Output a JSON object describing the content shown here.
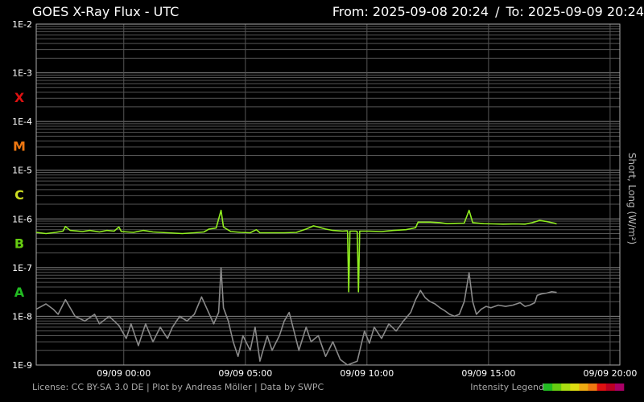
{
  "chart_data": {
    "type": "line",
    "title": "GOES X-Ray Flux - UTC",
    "range": {
      "from": "From: 2025-09-08 20:24",
      "sep": "/",
      "to": "To: 2025-09-09 20:24"
    },
    "ylabel": "Short, Long (W/m²)",
    "yscale": "log",
    "ylim": [
      1e-09,
      0.01
    ],
    "y_ticks": [
      "1E-9",
      "1E-8",
      "1E-7",
      "1E-6",
      "1E-5",
      "1E-4",
      "1E-3",
      "1E-2"
    ],
    "flare_classes": [
      {
        "label": "A",
        "color": "#22bb22",
        "y": 3.16e-08
      },
      {
        "label": "B",
        "color": "#66cc11",
        "y": 3.16e-07
      },
      {
        "label": "C",
        "color": "#ccdd22",
        "y": 3.16e-06
      },
      {
        "label": "M",
        "color": "#ee7711",
        "y": 3.16e-05
      },
      {
        "label": "X",
        "color": "#dd1111",
        "y": 0.000316
      }
    ],
    "x_range_hours": [
      20.4,
      44.4
    ],
    "x_ticks": [
      {
        "label": "09/09 00:00",
        "h": 24
      },
      {
        "label": "09/09 05:00",
        "h": 29
      },
      {
        "label": "09/09 10:00",
        "h": 34
      },
      {
        "label": "09/09 15:00",
        "h": 39
      },
      {
        "label": "09/09 20:00",
        "h": 44
      }
    ],
    "grid": true,
    "series": [
      {
        "color": "#90ee20",
        "points": [
          [
            20.4,
            5.3e-07
          ],
          [
            20.8,
            5e-07
          ],
          [
            21.2,
            5.3e-07
          ],
          [
            21.5,
            5.6e-07
          ],
          [
            21.6,
            7e-07
          ],
          [
            21.8,
            5.8e-07
          ],
          [
            22.3,
            5.5e-07
          ],
          [
            22.6,
            5.8e-07
          ],
          [
            23.0,
            5.4e-07
          ],
          [
            23.3,
            5.8e-07
          ],
          [
            23.6,
            5.6e-07
          ],
          [
            23.8,
            6.8e-07
          ],
          [
            23.9,
            5.5e-07
          ],
          [
            24.4,
            5.3e-07
          ],
          [
            24.8,
            5.8e-07
          ],
          [
            25.2,
            5.4e-07
          ],
          [
            25.8,
            5.2e-07
          ],
          [
            26.4,
            5e-07
          ],
          [
            26.9,
            5.2e-07
          ],
          [
            27.3,
            5.4e-07
          ],
          [
            27.5,
            6.2e-07
          ],
          [
            27.8,
            6.5e-07
          ],
          [
            28.0,
            1.5e-06
          ],
          [
            28.1,
            6.8e-07
          ],
          [
            28.4,
            5.5e-07
          ],
          [
            28.8,
            5.3e-07
          ],
          [
            29.2,
            5.2e-07
          ],
          [
            29.45,
            6e-07
          ],
          [
            29.6,
            5.2e-07
          ],
          [
            30.0,
            5.2e-07
          ],
          [
            30.6,
            5.2e-07
          ],
          [
            31.1,
            5.3e-07
          ],
          [
            31.5,
            6.2e-07
          ],
          [
            31.8,
            7.2e-07
          ],
          [
            32.0,
            6.8e-07
          ],
          [
            32.3,
            6.2e-07
          ],
          [
            32.6,
            5.8e-07
          ],
          [
            33.0,
            5.6e-07
          ],
          [
            33.2,
            5.7e-07
          ],
          [
            33.25,
            3.2e-08
          ],
          [
            33.3,
            5.6e-07
          ],
          [
            33.55,
            5.6e-07
          ],
          [
            33.6,
            5.5e-07
          ],
          [
            33.65,
            3.2e-08
          ],
          [
            33.7,
            5.6e-07
          ],
          [
            34.1,
            5.6e-07
          ],
          [
            34.6,
            5.5e-07
          ],
          [
            35.1,
            5.8e-07
          ],
          [
            35.6,
            6e-07
          ],
          [
            36.0,
            6.6e-07
          ],
          [
            36.1,
            8.6e-07
          ],
          [
            36.6,
            8.6e-07
          ],
          [
            37.0,
            8.4e-07
          ],
          [
            37.3,
            8e-07
          ],
          [
            37.6,
            8.1e-07
          ],
          [
            38.0,
            8.2e-07
          ],
          [
            38.2,
            1.5e-06
          ],
          [
            38.35,
            8.4e-07
          ],
          [
            38.8,
            8e-07
          ],
          [
            39.2,
            7.9e-07
          ],
          [
            39.6,
            7.8e-07
          ],
          [
            40.1,
            7.9e-07
          ],
          [
            40.5,
            7.8e-07
          ],
          [
            40.8,
            8.4e-07
          ],
          [
            41.1,
            9.3e-07
          ],
          [
            41.4,
            8.8e-07
          ],
          [
            41.7,
            8.2e-07
          ],
          [
            41.8,
            7.9e-07
          ]
        ]
      },
      {
        "color": "#8a8a8a",
        "points": [
          [
            20.4,
            1.4e-08
          ],
          [
            20.8,
            1.8e-08
          ],
          [
            21.1,
            1.4e-08
          ],
          [
            21.3,
            1.1e-08
          ],
          [
            21.6,
            2.2e-08
          ],
          [
            22.0,
            1e-08
          ],
          [
            22.4,
            8e-09
          ],
          [
            22.8,
            1.1e-08
          ],
          [
            23.0,
            7e-09
          ],
          [
            23.4,
            1e-08
          ],
          [
            23.8,
            6.5e-09
          ],
          [
            24.1,
            3.5e-09
          ],
          [
            24.3,
            7e-09
          ],
          [
            24.6,
            2.5e-09
          ],
          [
            24.9,
            7e-09
          ],
          [
            25.2,
            3e-09
          ],
          [
            25.5,
            6e-09
          ],
          [
            25.8,
            3.5e-09
          ],
          [
            26.0,
            6e-09
          ],
          [
            26.3,
            1e-08
          ],
          [
            26.6,
            8e-09
          ],
          [
            26.9,
            1.1e-08
          ],
          [
            27.2,
            2.5e-08
          ],
          [
            27.4,
            1.5e-08
          ],
          [
            27.7,
            7e-09
          ],
          [
            27.9,
            1.2e-08
          ],
          [
            28.0,
            1e-07
          ],
          [
            28.1,
            1.5e-08
          ],
          [
            28.3,
            8e-09
          ],
          [
            28.5,
            3e-09
          ],
          [
            28.7,
            1.5e-09
          ],
          [
            28.9,
            4e-09
          ],
          [
            29.2,
            2e-09
          ],
          [
            29.4,
            6e-09
          ],
          [
            29.6,
            1.2e-09
          ],
          [
            29.9,
            4e-09
          ],
          [
            30.1,
            2e-09
          ],
          [
            30.4,
            4e-09
          ],
          [
            30.6,
            8e-09
          ],
          [
            30.8,
            1.2e-08
          ],
          [
            31.0,
            5e-09
          ],
          [
            31.2,
            2e-09
          ],
          [
            31.5,
            6e-09
          ],
          [
            31.7,
            3e-09
          ],
          [
            32.0,
            4e-09
          ],
          [
            32.3,
            1.5e-09
          ],
          [
            32.6,
            3e-09
          ],
          [
            32.9,
            1.3e-09
          ],
          [
            33.2,
            1e-09
          ],
          [
            33.6,
            1.2e-09
          ],
          [
            33.9,
            5e-09
          ],
          [
            34.1,
            2.8e-09
          ],
          [
            34.3,
            6e-09
          ],
          [
            34.6,
            3.5e-09
          ],
          [
            34.9,
            7e-09
          ],
          [
            35.2,
            5e-09
          ],
          [
            35.5,
            8e-09
          ],
          [
            35.8,
            1.2e-08
          ],
          [
            36.0,
            2.2e-08
          ],
          [
            36.2,
            3.4e-08
          ],
          [
            36.4,
            2.4e-08
          ],
          [
            36.6,
            2e-08
          ],
          [
            36.8,
            1.8e-08
          ],
          [
            37.0,
            1.5e-08
          ],
          [
            37.2,
            1.3e-08
          ],
          [
            37.4,
            1.1e-08
          ],
          [
            37.6,
            1e-08
          ],
          [
            37.8,
            1.1e-08
          ],
          [
            38.0,
            2e-08
          ],
          [
            38.2,
            7.8e-08
          ],
          [
            38.35,
            2e-08
          ],
          [
            38.5,
            1.1e-08
          ],
          [
            38.7,
            1.4e-08
          ],
          [
            38.9,
            1.6e-08
          ],
          [
            39.1,
            1.5e-08
          ],
          [
            39.4,
            1.7e-08
          ],
          [
            39.7,
            1.6e-08
          ],
          [
            40.0,
            1.7e-08
          ],
          [
            40.3,
            1.9e-08
          ],
          [
            40.5,
            1.6e-08
          ],
          [
            40.7,
            1.7e-08
          ],
          [
            40.9,
            1.9e-08
          ],
          [
            41.0,
            2.7e-08
          ],
          [
            41.2,
            2.9e-08
          ],
          [
            41.4,
            3e-08
          ],
          [
            41.6,
            3.2e-08
          ],
          [
            41.8,
            3.1e-08
          ]
        ]
      }
    ]
  },
  "footer": {
    "license": "License: CC BY-SA 3.0 DE | Plot by Andreas Möller | Data by SWPC",
    "legend_label": "Intensity Legend",
    "legend_colors": [
      "#22bb22",
      "#66cc11",
      "#aadd11",
      "#dddd11",
      "#eeaa11",
      "#ee7711",
      "#dd1111",
      "#bb0022",
      "#aa0066"
    ]
  }
}
